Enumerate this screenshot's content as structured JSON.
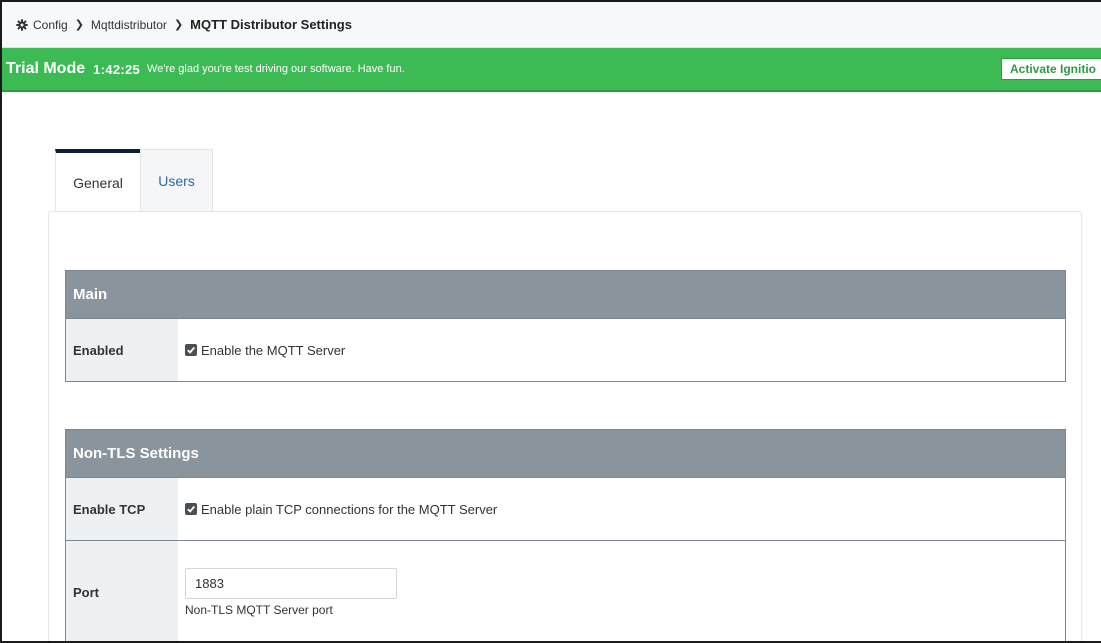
{
  "breadcrumb": {
    "icon": "gear-icon",
    "items": [
      "Config",
      "Mqttdistributor"
    ],
    "current": "MQTT Distributor Settings"
  },
  "trial": {
    "mode": "Trial Mode",
    "timer": "1:42:25",
    "message": "We're glad you're test driving our software. Have fun.",
    "activate_label": "Activate Ignitio",
    "color": "#3cba54"
  },
  "tabs": [
    {
      "label": "General",
      "active": true
    },
    {
      "label": "Users",
      "active": false
    }
  ],
  "sections": {
    "main": {
      "title": "Main",
      "enabled_label": "Enabled",
      "enabled_text": "Enable the MQTT Server",
      "enabled_checked": true
    },
    "non_tls": {
      "title": "Non-TLS Settings",
      "tcp_label": "Enable TCP",
      "tcp_text": "Enable plain TCP connections for the MQTT Server",
      "tcp_checked": true,
      "port_label": "Port",
      "port_value": "1883",
      "port_desc": "Non-TLS MQTT Server port"
    }
  }
}
